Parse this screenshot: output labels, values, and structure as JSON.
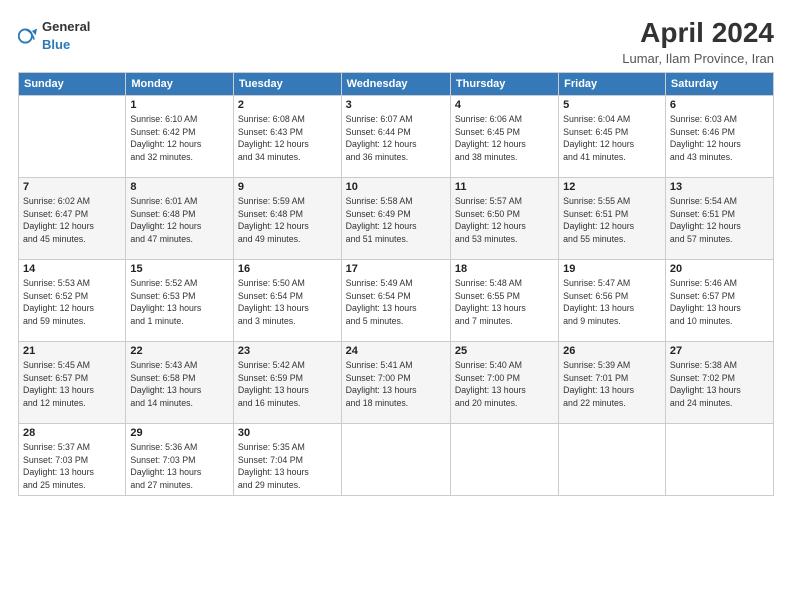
{
  "header": {
    "logo_general": "General",
    "logo_blue": "Blue",
    "month_title": "April 2024",
    "location": "Lumar, Ilam Province, Iran"
  },
  "weekdays": [
    "Sunday",
    "Monday",
    "Tuesday",
    "Wednesday",
    "Thursday",
    "Friday",
    "Saturday"
  ],
  "weeks": [
    [
      {
        "day": "",
        "info": ""
      },
      {
        "day": "1",
        "info": "Sunrise: 6:10 AM\nSunset: 6:42 PM\nDaylight: 12 hours\nand 32 minutes."
      },
      {
        "day": "2",
        "info": "Sunrise: 6:08 AM\nSunset: 6:43 PM\nDaylight: 12 hours\nand 34 minutes."
      },
      {
        "day": "3",
        "info": "Sunrise: 6:07 AM\nSunset: 6:44 PM\nDaylight: 12 hours\nand 36 minutes."
      },
      {
        "day": "4",
        "info": "Sunrise: 6:06 AM\nSunset: 6:45 PM\nDaylight: 12 hours\nand 38 minutes."
      },
      {
        "day": "5",
        "info": "Sunrise: 6:04 AM\nSunset: 6:45 PM\nDaylight: 12 hours\nand 41 minutes."
      },
      {
        "day": "6",
        "info": "Sunrise: 6:03 AM\nSunset: 6:46 PM\nDaylight: 12 hours\nand 43 minutes."
      }
    ],
    [
      {
        "day": "7",
        "info": "Sunrise: 6:02 AM\nSunset: 6:47 PM\nDaylight: 12 hours\nand 45 minutes."
      },
      {
        "day": "8",
        "info": "Sunrise: 6:01 AM\nSunset: 6:48 PM\nDaylight: 12 hours\nand 47 minutes."
      },
      {
        "day": "9",
        "info": "Sunrise: 5:59 AM\nSunset: 6:48 PM\nDaylight: 12 hours\nand 49 minutes."
      },
      {
        "day": "10",
        "info": "Sunrise: 5:58 AM\nSunset: 6:49 PM\nDaylight: 12 hours\nand 51 minutes."
      },
      {
        "day": "11",
        "info": "Sunrise: 5:57 AM\nSunset: 6:50 PM\nDaylight: 12 hours\nand 53 minutes."
      },
      {
        "day": "12",
        "info": "Sunrise: 5:55 AM\nSunset: 6:51 PM\nDaylight: 12 hours\nand 55 minutes."
      },
      {
        "day": "13",
        "info": "Sunrise: 5:54 AM\nSunset: 6:51 PM\nDaylight: 12 hours\nand 57 minutes."
      }
    ],
    [
      {
        "day": "14",
        "info": "Sunrise: 5:53 AM\nSunset: 6:52 PM\nDaylight: 12 hours\nand 59 minutes."
      },
      {
        "day": "15",
        "info": "Sunrise: 5:52 AM\nSunset: 6:53 PM\nDaylight: 13 hours\nand 1 minute."
      },
      {
        "day": "16",
        "info": "Sunrise: 5:50 AM\nSunset: 6:54 PM\nDaylight: 13 hours\nand 3 minutes."
      },
      {
        "day": "17",
        "info": "Sunrise: 5:49 AM\nSunset: 6:54 PM\nDaylight: 13 hours\nand 5 minutes."
      },
      {
        "day": "18",
        "info": "Sunrise: 5:48 AM\nSunset: 6:55 PM\nDaylight: 13 hours\nand 7 minutes."
      },
      {
        "day": "19",
        "info": "Sunrise: 5:47 AM\nSunset: 6:56 PM\nDaylight: 13 hours\nand 9 minutes."
      },
      {
        "day": "20",
        "info": "Sunrise: 5:46 AM\nSunset: 6:57 PM\nDaylight: 13 hours\nand 10 minutes."
      }
    ],
    [
      {
        "day": "21",
        "info": "Sunrise: 5:45 AM\nSunset: 6:57 PM\nDaylight: 13 hours\nand 12 minutes."
      },
      {
        "day": "22",
        "info": "Sunrise: 5:43 AM\nSunset: 6:58 PM\nDaylight: 13 hours\nand 14 minutes."
      },
      {
        "day": "23",
        "info": "Sunrise: 5:42 AM\nSunset: 6:59 PM\nDaylight: 13 hours\nand 16 minutes."
      },
      {
        "day": "24",
        "info": "Sunrise: 5:41 AM\nSunset: 7:00 PM\nDaylight: 13 hours\nand 18 minutes."
      },
      {
        "day": "25",
        "info": "Sunrise: 5:40 AM\nSunset: 7:00 PM\nDaylight: 13 hours\nand 20 minutes."
      },
      {
        "day": "26",
        "info": "Sunrise: 5:39 AM\nSunset: 7:01 PM\nDaylight: 13 hours\nand 22 minutes."
      },
      {
        "day": "27",
        "info": "Sunrise: 5:38 AM\nSunset: 7:02 PM\nDaylight: 13 hours\nand 24 minutes."
      }
    ],
    [
      {
        "day": "28",
        "info": "Sunrise: 5:37 AM\nSunset: 7:03 PM\nDaylight: 13 hours\nand 25 minutes."
      },
      {
        "day": "29",
        "info": "Sunrise: 5:36 AM\nSunset: 7:03 PM\nDaylight: 13 hours\nand 27 minutes."
      },
      {
        "day": "30",
        "info": "Sunrise: 5:35 AM\nSunset: 7:04 PM\nDaylight: 13 hours\nand 29 minutes."
      },
      {
        "day": "",
        "info": ""
      },
      {
        "day": "",
        "info": ""
      },
      {
        "day": "",
        "info": ""
      },
      {
        "day": "",
        "info": ""
      }
    ]
  ]
}
